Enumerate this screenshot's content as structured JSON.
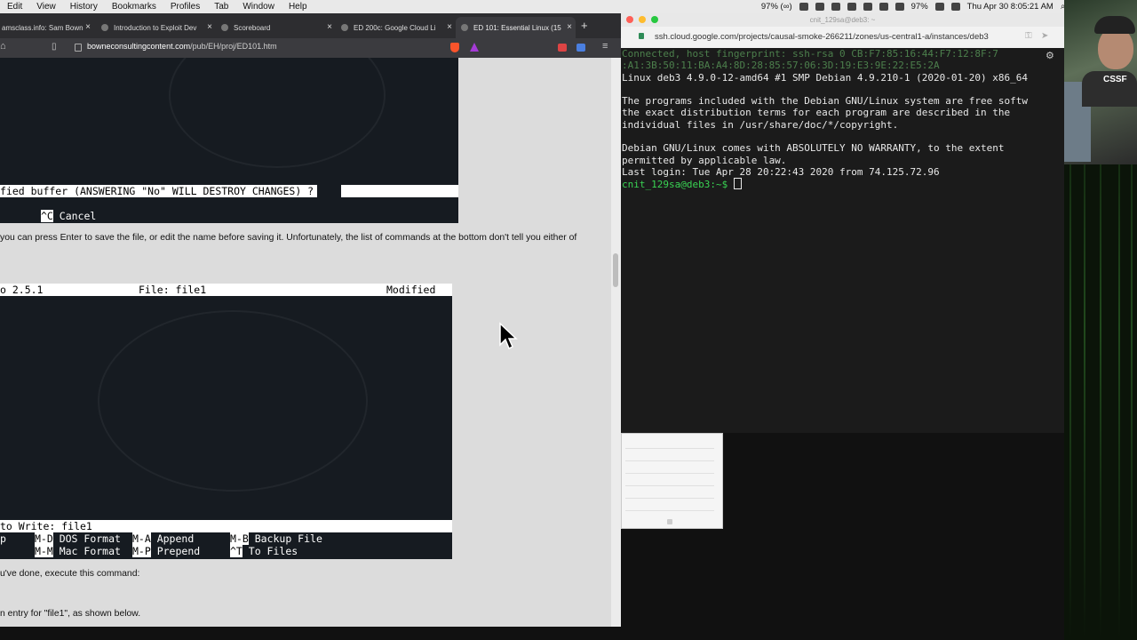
{
  "menubar": {
    "items": [
      "Edit",
      "View",
      "History",
      "Bookmarks",
      "Profiles",
      "Tab",
      "Window",
      "Help"
    ],
    "status_left": "97% (∞)",
    "battery": "97%",
    "datetime": "Thu Apr 30  8:05:21 AM"
  },
  "browser": {
    "tabs": [
      {
        "label": "amsclass.info: Sam Bown",
        "close": "×"
      },
      {
        "label": "Introduction to Exploit Dev",
        "close": "×"
      },
      {
        "label": "Scoreboard",
        "close": "×"
      },
      {
        "label": "ED 200c: Google Cloud Li",
        "close": "×"
      },
      {
        "label": "ED 101: Essential Linux (15",
        "close": "×"
      }
    ],
    "new_tab": "+",
    "url_domain": "bowneconsultingcontent.com",
    "url_path": "/pub/EH/proj/ED101.htm"
  },
  "content": {
    "term1": {
      "save_prompt": "fied buffer (ANSWERING \"No\" WILL DESTROY CHANGES) ? ",
      "cancel_key": "^C",
      "cancel_label": " Cancel"
    },
    "para1": "you can press Enter to save the file, or edit the name before saving it. Unfortunately, the list of commands at the bottom don't tell you either of",
    "term2": {
      "header_version": "o 2.5.1",
      "header_file": "File: file1",
      "header_status": "Modified",
      "write_prompt": " to Write: file1",
      "shortcuts": [
        {
          "key": "M-D",
          "label": " DOS Format"
        },
        {
          "key": "M-A",
          "label": " Append"
        },
        {
          "key": "M-B",
          "label": " Backup File"
        },
        {
          "key": "M-M",
          "label": " Mac Format"
        },
        {
          "key": "M-P",
          "label": " Prepend"
        },
        {
          "key": "^T",
          "label": " To Files"
        }
      ],
      "left_fragment": "p"
    },
    "para2": "u've done, execute this command:",
    "para3": "n entry for \"file1\", as shown below."
  },
  "terminal": {
    "title": "cnit_129sa@deb3: ~",
    "url": "ssh.cloud.google.com/projects/causal-smoke-266211/zones/us-central1-a/instances/deb3",
    "lines": [
      {
        "text": "Connected, host fingerprint: ssh-rsa 0 CB:F7:85:16:44:F7:12:8F:7",
        "cls": "dim"
      },
      {
        "text": ":A1:3B:50:11:BA:A4:8D:28:85:57:06:3D:19:E3:9E:22:E5:2A",
        "cls": "dim"
      },
      {
        "text": "Linux deb3 4.9.0-12-amd64 #1 SMP Debian 4.9.210-1 (2020-01-20) x86_64",
        "cls": ""
      },
      {
        "text": "",
        "cls": ""
      },
      {
        "text": "The programs included with the Debian GNU/Linux system are free softw",
        "cls": ""
      },
      {
        "text": "the exact distribution terms for each program are described in the",
        "cls": ""
      },
      {
        "text": "individual files in /usr/share/doc/*/copyright.",
        "cls": ""
      },
      {
        "text": "",
        "cls": ""
      },
      {
        "text": "Debian GNU/Linux comes with ABSOLUTELY NO WARRANTY, to the extent",
        "cls": ""
      },
      {
        "text": "permitted by applicable law.",
        "cls": ""
      },
      {
        "text": "Last login: Tue Apr 28 20:22:43 2020 from 74.125.72.96",
        "cls": ""
      }
    ],
    "prompt": "cnit_129sa@deb3:~$ "
  },
  "webcam": {
    "logo": "CSSF"
  },
  "colors": {
    "prompt_green": "#39d353",
    "terminal_bg": "#1b1b1b",
    "tab_bar": "#2d2d30",
    "page_bg": "#dcdcdc"
  }
}
